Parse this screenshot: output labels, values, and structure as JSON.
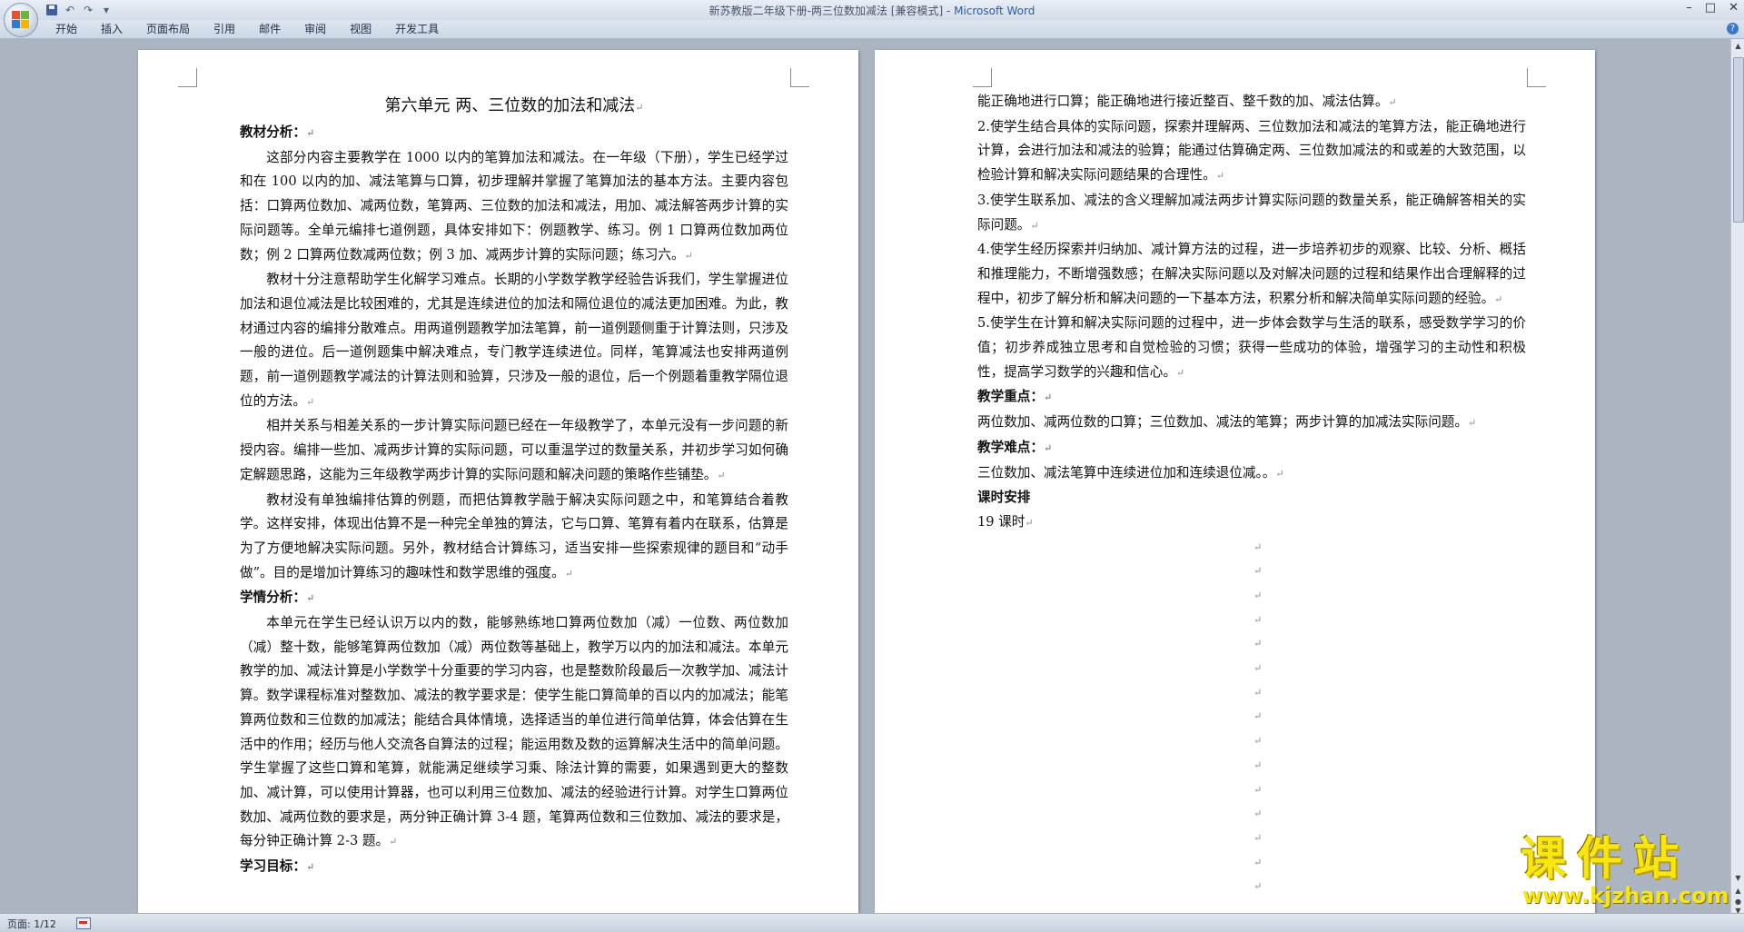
{
  "window": {
    "title": "新苏教版二年级下册-两三位数加减法 [兼容模式] - ",
    "app_name": "Microsoft Word",
    "controls": [
      "–",
      "□",
      "✕"
    ]
  },
  "quick_access": {
    "undo": "↶",
    "redo": "↷",
    "more": "▾"
  },
  "ribbon": {
    "tabs": [
      "开始",
      "插入",
      "页面布局",
      "引用",
      "邮件",
      "审阅",
      "视图",
      "开发工具"
    ],
    "help": "?"
  },
  "page1": {
    "title": "第六单元  两、三位数的加法和减法",
    "h1": "教材分析：",
    "p1": "这部分内容主要教学在 1000 以内的笔算加法和减法。在一年级（下册），学生已经学过和在 100 以内的加、减法笔算与口算，初步理解并掌握了笔算加法的基本方法。主要内容包括：口算两位数加、减两位数，笔算两、三位数的加法和减法，用加、减法解答两步计算的实际问题等。全单元编排七道例题，具体安排如下：例题教学、练习。例 1 口算两位数加两位数；例 2 口算两位数减两位数；例 3 加、减两步计算的实际问题；练习六。",
    "p2": "教材十分注意帮助学生化解学习难点。长期的小学数学教学经验告诉我们，学生掌握进位加法和退位减法是比较困难的，尤其是连续进位的加法和隔位退位的减法更加困难。为此，教材通过内容的编排分散难点。用两道例题教学加法笔算，前一道例题侧重于计算法则，只涉及一般的进位。后一道例题集中解决难点，专门教学连续进位。同样，笔算减法也安排两道例题，前一道例题教学减法的计算法则和验算，只涉及一般的退位，后一个例题着重教学隔位退位的方法。",
    "p3": "相并关系与相差关系的一步计算实际问题已经在一年级教学了，本单元没有一步问题的新授内容。编排一些加、减两步计算的实际问题，可以重温学过的数量关系，并初步学习如何确定解题思路，这能为三年级教学两步计算的实际问题和解决问题的策略作些铺垫。",
    "p4": "教材没有单独编排估算的例题，而把估算教学融于解决实际问题之中，和笔算结合着教学。这样安排，体现出估算不是一种完全单独的算法，它与口算、笔算有着内在联系，估算是为了方便地解决实际问题。另外，教材结合计算练习，适当安排一些探索规律的题目和“动手做”。目的是增加计算练习的趣味性和数学思维的强度。",
    "h2": "学情分析：",
    "p5": "本单元在学生已经认识万以内的数，能够熟练地口算两位数加（减）一位数、两位数加（减）整十数，能够笔算两位数加（减）两位数等基础上，教学万以内的加法和减法。本单元教学的加、减法计算是小学数学十分重要的学习内容，也是整数阶段最后一次教学加、减法计算。数学课程标准对整数加、减法的教学要求是：使学生能口算简单的百以内的加减法；能笔算两位数和三位数的加减法；能结合具体情境，选择适当的单位进行简单估算，体会估算在生活中的作用；经历与他人交流各自算法的过程；能运用数及数的运算解决生活中的简单问题。学生掌握了这些口算和笔算，就能满足继续学习乘、除法计算的需要，如果遇到更大的整数加、减计算，可以使用计算器，也可以利用三位数加、减法的经验进行计算。对学生口算两位数加、减两位数的要求是，两分钟正确计算 3-4 题，笔算两位数和三位数加、减法的要求是，每分钟正确计算 2-3 题。",
    "h3": "学习目标："
  },
  "page2": {
    "l0": "能正确地进行口算；能正确地进行接近整百、整千数的加、减法估算。",
    "l2": "2.使学生结合具体的实际问题，探索并理解两、三位数加法和减法的笔算方法，能正确地进行计算，会进行加法和减法的验算；能通过估算确定两、三位数加减法的和或差的大致范围，以检验计算和解决实际问题结果的合理性。",
    "l3": "3.使学生联系加、减法的含义理解加减法两步计算实际问题的数量关系，能正确解答相关的实际问题。",
    "l4": "4.使学生经历探索并归纳加、减计算方法的过程，进一步培养初步的观察、比较、分析、概括和推理能力，不断增强数感；在解决实际问题以及对解决问题的过程和结果作出合理解释的过程中，初步了解分析和解决问题的一下基本方法，积累分析和解决简单实际问题的经验。",
    "l5": "5.使学生在计算和解决实际问题的过程中，进一步体会数学与生活的联系，感受数学学习的价值；初步养成独立思考和自觉检验的习惯；获得一些成功的体验，增强学习的主动性和积极性，提高学习数学的兴趣和信心。",
    "h_key": "教学重点：",
    "key": "两位数加、减两位数的口算；三位数加、减法的笔算；两步计算的加减法实际问题。",
    "h_diff": "教学难点：",
    "diff": "三位数加、减法笔算中连续进位加和连续退位减。。",
    "h_hours": "课时安排",
    "hours": " 19 课时"
  },
  "para_mark": "↵",
  "statusbar": {
    "page": "页面: 1/12"
  },
  "watermark": {
    "cn": "课件站",
    "url": "www.kjzhan.com"
  }
}
